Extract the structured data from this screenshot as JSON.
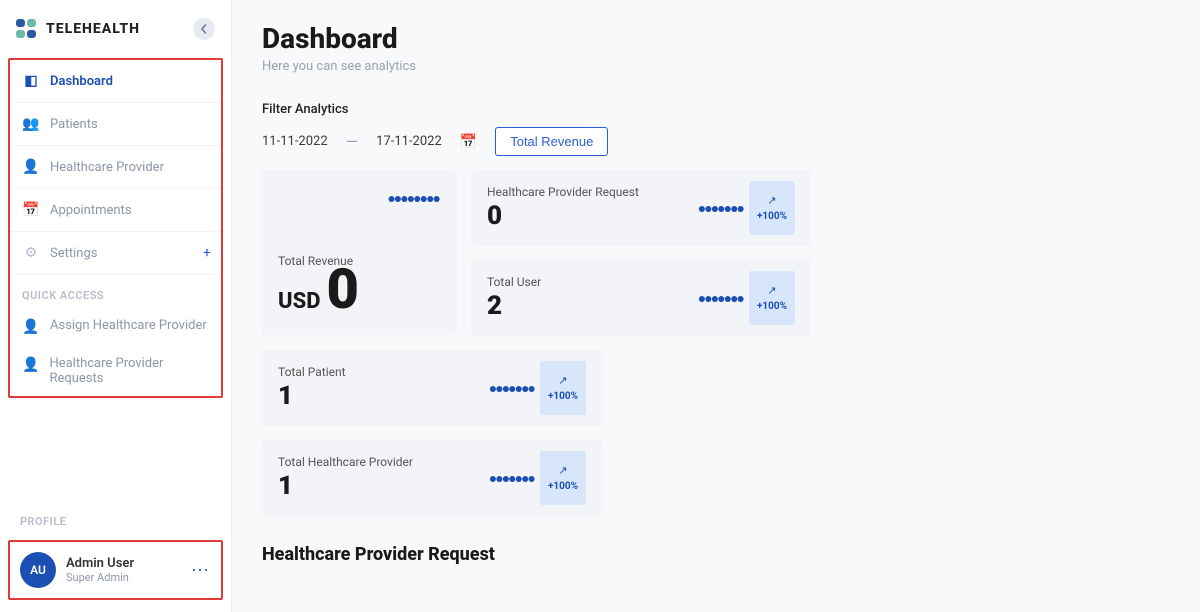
{
  "app": {
    "name": "TELEHEALTH"
  },
  "sidebar": {
    "items": [
      {
        "label": "Dashboard"
      },
      {
        "label": "Patients"
      },
      {
        "label": "Healthcare Provider"
      },
      {
        "label": "Appointments"
      },
      {
        "label": "Settings"
      }
    ],
    "quick_access_label": "QUICK ACCESS",
    "quick_access": [
      {
        "label": "Assign Healthcare Provider"
      },
      {
        "label": "Healthcare Provider Requests"
      }
    ],
    "profile_label": "PROFILE",
    "profile": {
      "initials": "AU",
      "name": "Admin User",
      "role": "Super Admin"
    }
  },
  "page": {
    "title": "Dashboard",
    "subtitle": "Here you can see analytics",
    "filter_label": "Filter Analytics",
    "date_from": "11-11-2022",
    "date_to": "17-11-2022",
    "revenue_button": "Total Revenue"
  },
  "cards": {
    "revenue": {
      "label": "Total Revenue",
      "currency": "USD",
      "value": "0"
    },
    "hcp_request": {
      "label": "Healthcare Provider Request",
      "value": "0",
      "trend": "+100%"
    },
    "total_user": {
      "label": "Total User",
      "value": "2",
      "trend": "+100%"
    },
    "total_patient": {
      "label": "Total Patient",
      "value": "1",
      "trend": "+100%"
    },
    "total_hcp": {
      "label": "Total Healthcare Provider",
      "value": "1",
      "trend": "+100%"
    }
  },
  "section": {
    "hcp_request_heading": "Healthcare Provider Request"
  }
}
